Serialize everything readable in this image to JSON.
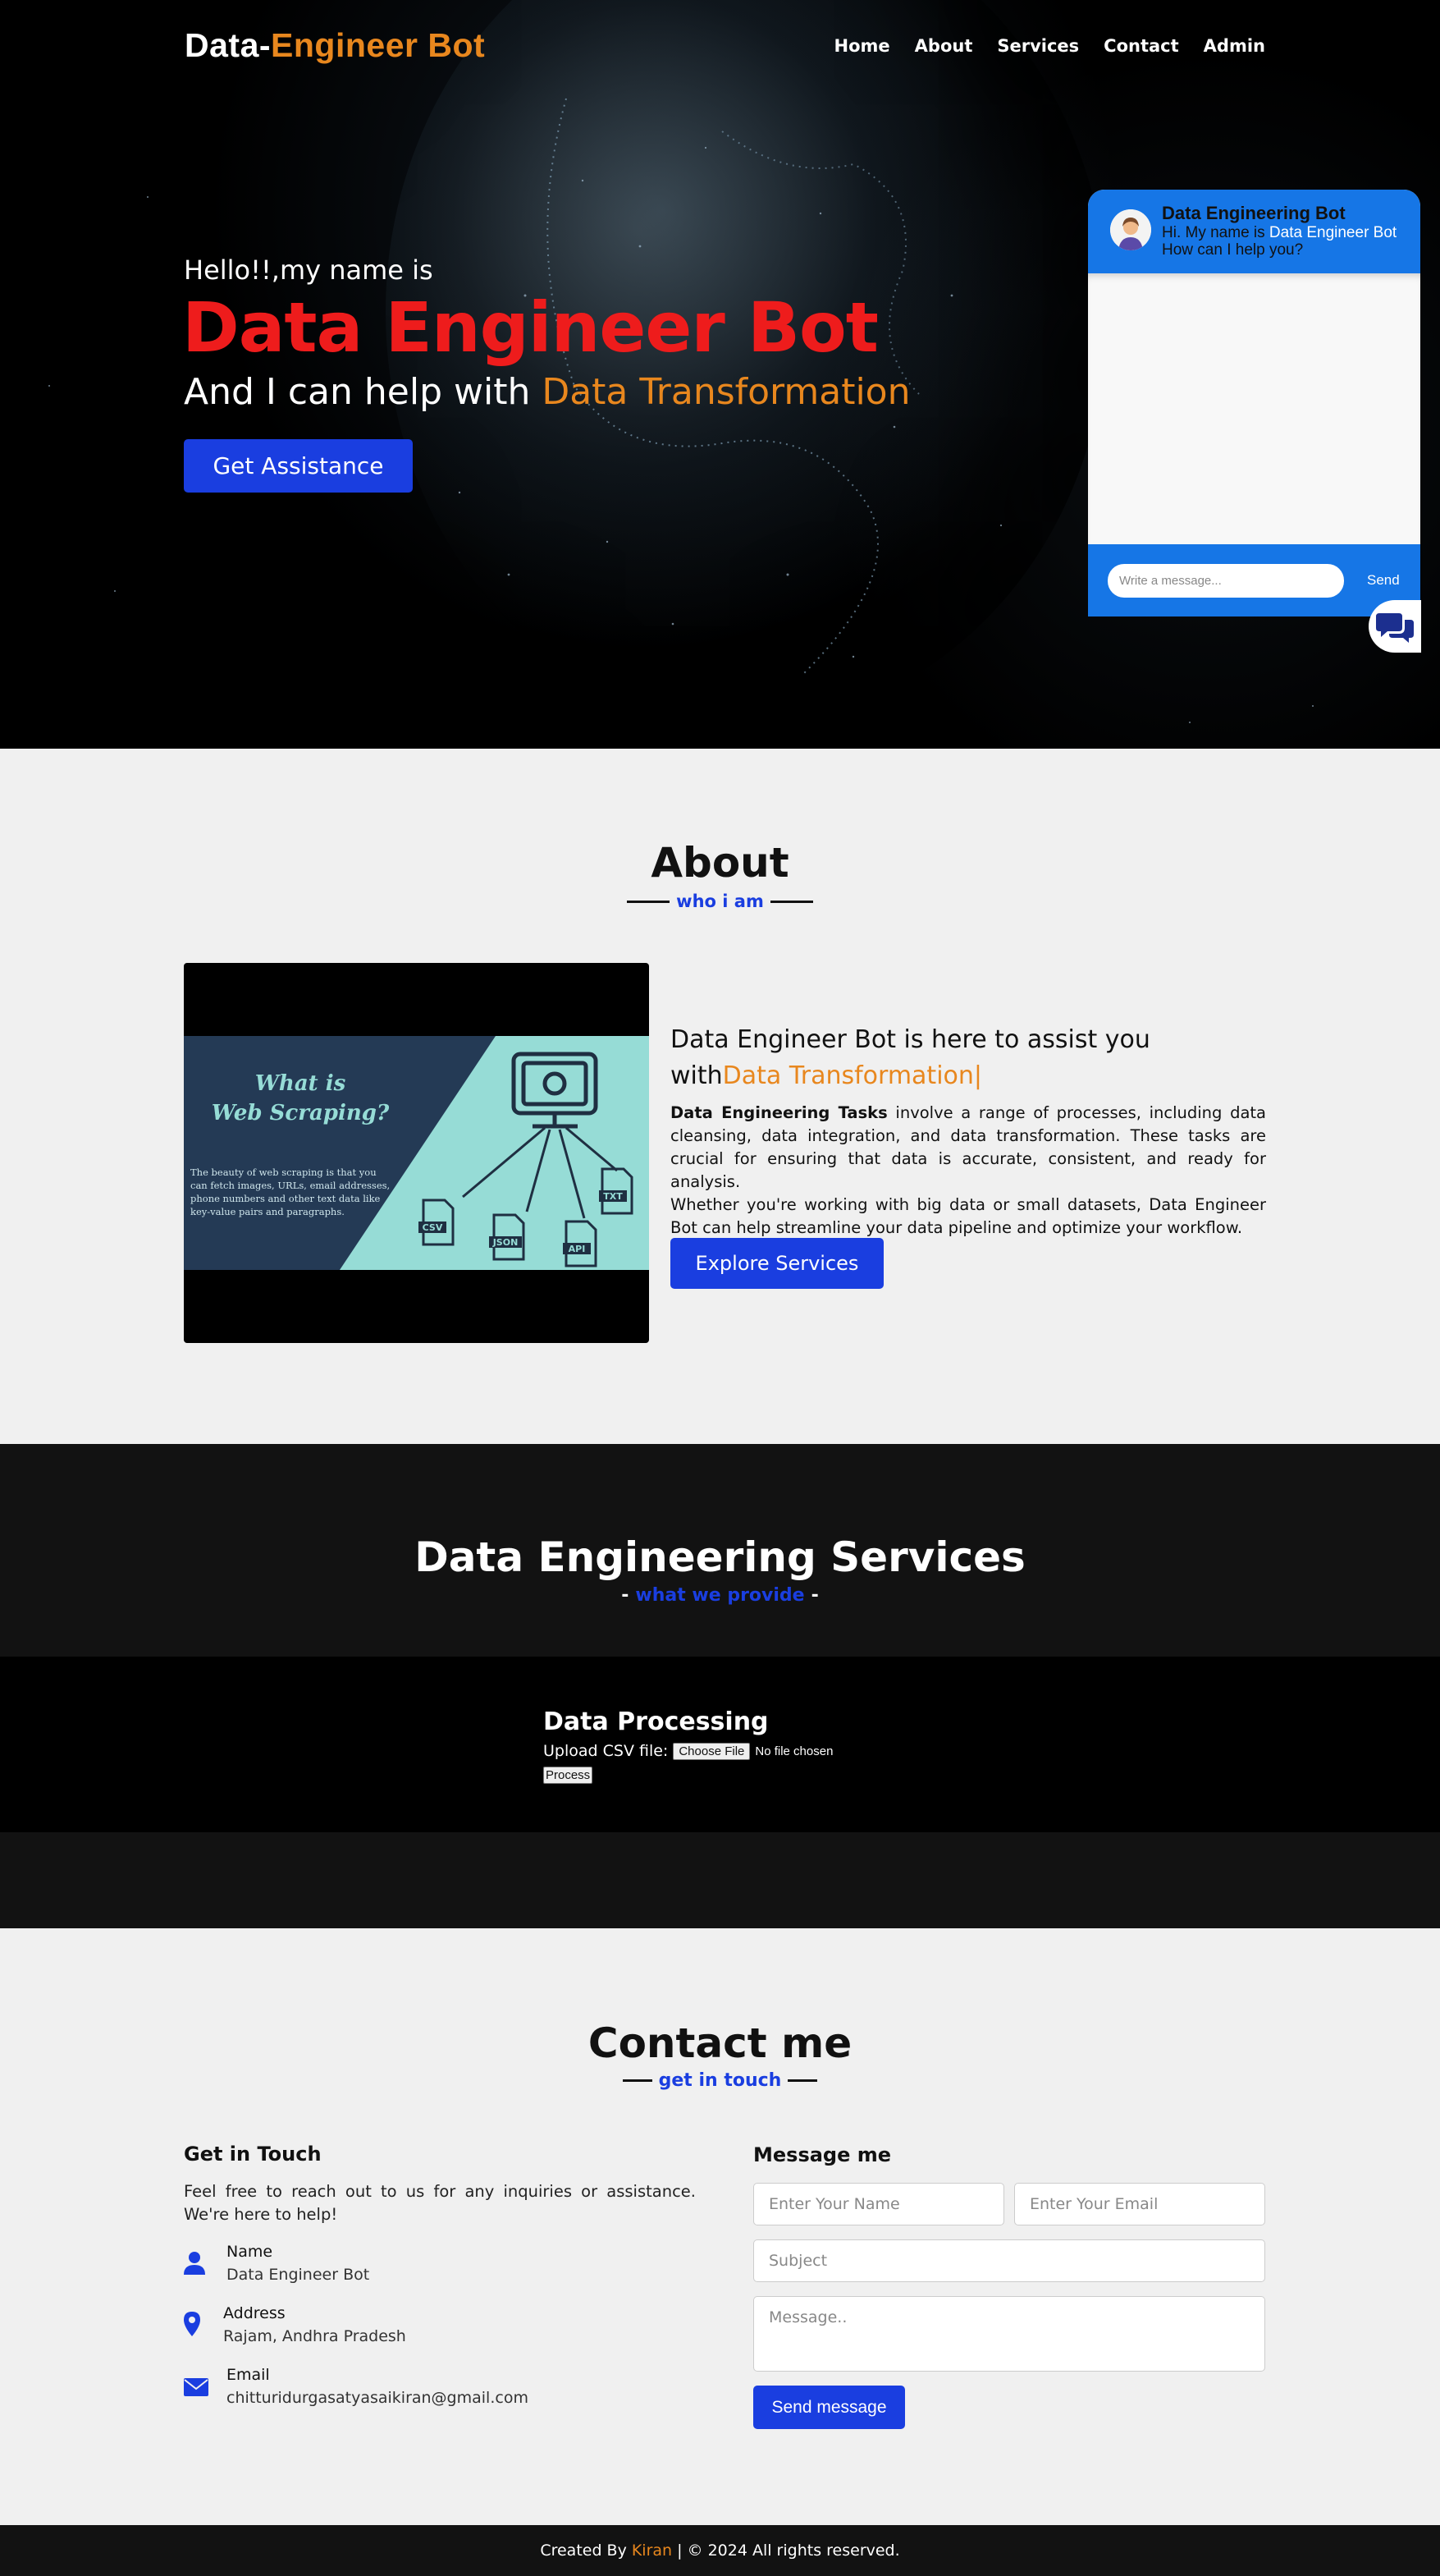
{
  "nav": {
    "logo_prefix": "Data-",
    "logo_accent": "Engineer Bot",
    "links": [
      "Home",
      "About",
      "Services",
      "Contact",
      "Admin"
    ]
  },
  "hero": {
    "greeting": "Hello!!,my name is",
    "name": "Data Engineer Bot",
    "help_prefix": "And I can help with ",
    "help_accent": "Data Transformation",
    "button": "Get Assistance"
  },
  "chat": {
    "title": "Data Engineering Bot",
    "intro_prefix": "Hi. My name is ",
    "intro_name": "Data Engineer Bot",
    "intro_question": "How can I help you?",
    "input_placeholder": "Write a message...",
    "send": "Send",
    "toggle_icon": "chat-bubbles-icon"
  },
  "about": {
    "title": "About",
    "subtitle": "who i am",
    "media": {
      "heading_line1": "What is",
      "heading_line2": "Web Scraping?",
      "body_lines": [
        "The beauty of web scraping is that you",
        "can fetch images, URLs, email addresses,",
        "phone numbers and other text data like",
        "key-value pairs and paragraphs."
      ],
      "file_tags": [
        "CSV",
        "JSON",
        "API",
        "TXT"
      ]
    },
    "heading_prefix": "Data Engineer Bot is here to assist you with",
    "heading_accent": "Data Transformation|",
    "text_bold": "Data Engineering Tasks",
    "text_rest": " involve a range of processes, including data cleansing, data integration, and data transformation. These tasks are crucial for ensuring that data is accurate, consistent, and ready for analysis.",
    "text_line2": "Whether you're working with big data or small datasets, Data Engineer Bot can help streamline your data pipeline and optimize your workflow.",
    "button": "Explore Services"
  },
  "services": {
    "title": "Data Engineering Services",
    "subtitle": "what we provide",
    "processing": {
      "title": "Data Processing",
      "upload_label": "Upload CSV file:",
      "choose_file": "Choose File",
      "no_file": "No file chosen",
      "process": "Process"
    }
  },
  "contact": {
    "title": "Contact me",
    "subtitle": "get in touch",
    "git_title": "Get in Touch",
    "git_text": "Feel free to reach out to us for any inquiries or assistance. We're here to help!",
    "info": [
      {
        "label": "Name",
        "value": "Data Engineer Bot",
        "icon": "user-icon"
      },
      {
        "label": "Address",
        "value": "Rajam, Andhra Pradesh",
        "icon": "map-marker-icon"
      },
      {
        "label": "Email",
        "value": "chitturidurgasatyasaikiran@gmail.com",
        "icon": "envelope-icon"
      }
    ],
    "form": {
      "title": "Message me",
      "name_placeholder": "Enter Your Name",
      "email_placeholder": "Enter Your Email",
      "subject_placeholder": "Subject",
      "message_placeholder": "Message..",
      "send": "Send message"
    }
  },
  "footer": {
    "created_by": "Created By",
    "author": "Kiran",
    "rest": "| © 2024 All rights reserved."
  },
  "colors": {
    "accent_orange": "#e8871e",
    "hero_red": "#ee1c1c",
    "primary_blue": "#1a3ee0",
    "chat_blue": "#1676e6"
  }
}
